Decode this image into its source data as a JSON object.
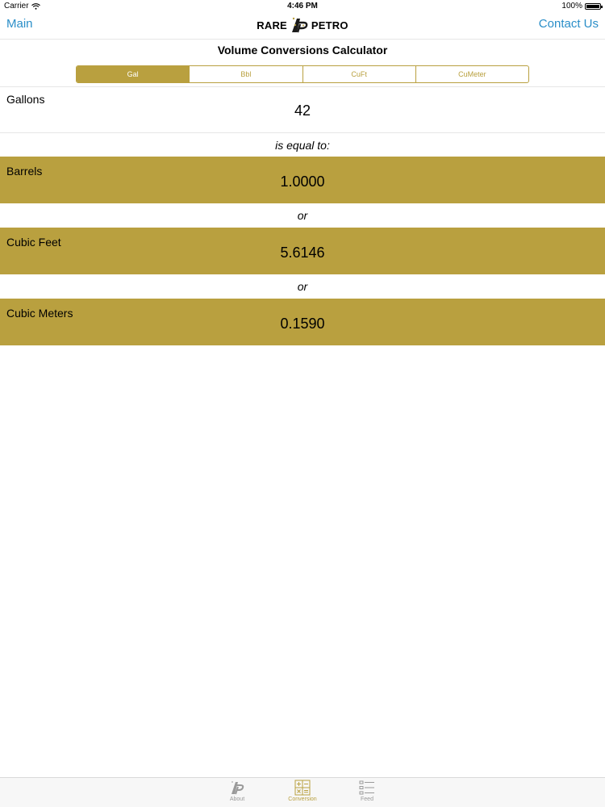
{
  "status_bar": {
    "carrier": "Carrier",
    "time": "4:46 PM",
    "battery": "100%",
    "battery_level": 1.0
  },
  "nav": {
    "left_label": "Main",
    "right_label": "Contact Us",
    "logo_left": "RARE",
    "logo_right": "PETRO"
  },
  "page_title": "Volume Conversions Calculator",
  "segments": [
    {
      "label": "Gal",
      "active": true
    },
    {
      "label": "Bbl",
      "active": false
    },
    {
      "label": "CuFt",
      "active": false
    },
    {
      "label": "CuMeter",
      "active": false
    }
  ],
  "input": {
    "label": "Gallons",
    "value": "42"
  },
  "equal_text": "is equal to:",
  "or_text": "or",
  "results": [
    {
      "label": "Barrels",
      "value": "1.0000"
    },
    {
      "label": "Cubic Feet",
      "value": "5.6146"
    },
    {
      "label": "Cubic Meters",
      "value": "0.1590"
    }
  ],
  "tabs": [
    {
      "label": "About",
      "icon": "logo-icon",
      "active": false
    },
    {
      "label": "Conversion",
      "icon": "calculator-icon",
      "active": true
    },
    {
      "label": "Feed",
      "icon": "list-icon",
      "active": false
    }
  ],
  "colors": {
    "accent": "#b9a03f",
    "link": "#2a8ec8",
    "tab_inactive": "#999999"
  }
}
